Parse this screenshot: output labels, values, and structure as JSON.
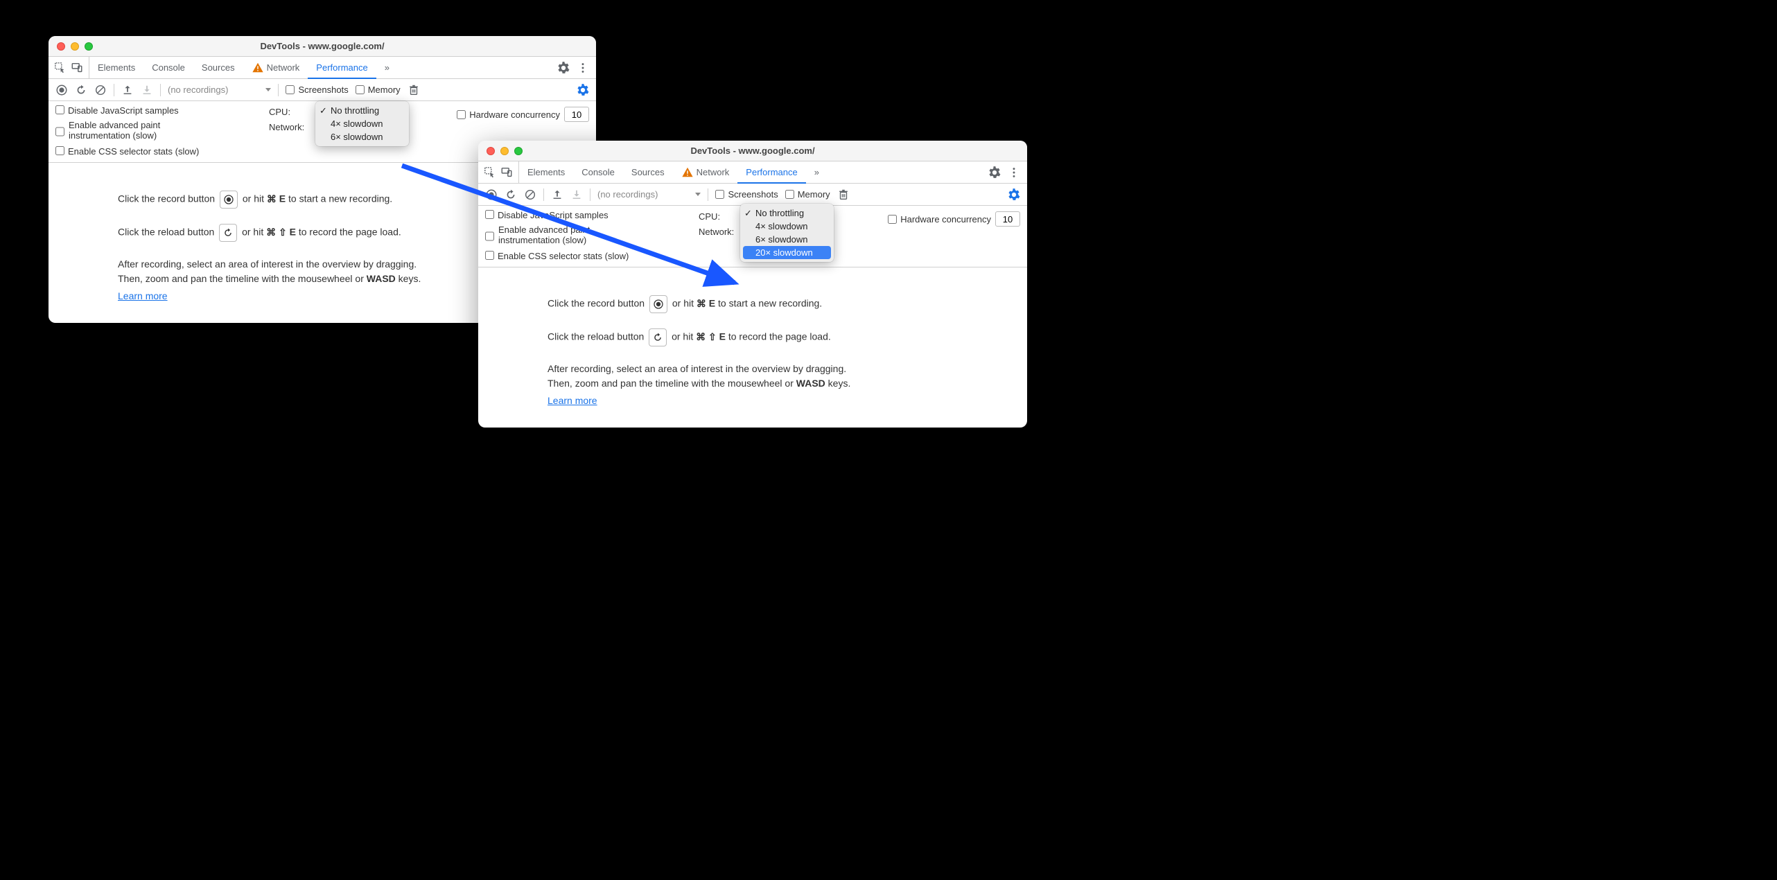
{
  "window_title": "DevTools - www.google.com/",
  "tabs": {
    "elements": "Elements",
    "console": "Console",
    "sources": "Sources",
    "network": "Network",
    "performance": "Performance",
    "more": "»"
  },
  "toolbar": {
    "recordings_label": "(no recordings)",
    "screenshots": "Screenshots",
    "memory": "Memory"
  },
  "settings": {
    "disable_js_samples": "Disable JavaScript samples",
    "advanced_paint_line1": "Enable advanced paint",
    "advanced_paint_line2": "instrumentation (slow)",
    "css_selector_stats": "Enable CSS selector stats (slow)",
    "cpu_label": "CPU:",
    "network_label": "Network:",
    "hw_concurrency": "Hardware concurrency",
    "hw_value": "10"
  },
  "cpu_menu_a": {
    "items": [
      "No throttling",
      "4× slowdown",
      "6× slowdown"
    ],
    "selected_index": 0
  },
  "cpu_menu_b": {
    "items": [
      "No throttling",
      "4× slowdown",
      "6× slowdown",
      "20× slowdown"
    ],
    "selected_index": 0,
    "highlight_index": 3
  },
  "help": {
    "record_pre": "Click the record button ",
    "record_post": " or hit ",
    "record_key": "E",
    "record_tail": " to start a new recording.",
    "reload_pre": "Click the reload button ",
    "reload_post": " or hit ",
    "reload_key": "E",
    "reload_tail": " to record the page load.",
    "after_line1": "After recording, select an area of interest in the overview by dragging.",
    "after_line2a": "Then, zoom and pan the timeline with the mousewheel or ",
    "after_wasd": "WASD",
    "after_line2b": " keys.",
    "learn_more": "Learn more"
  }
}
